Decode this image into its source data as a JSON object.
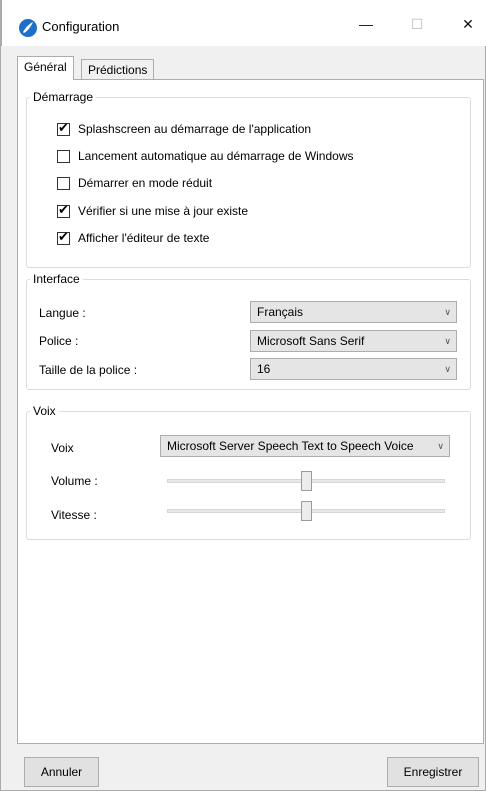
{
  "window": {
    "title": "Configuration"
  },
  "tabs": [
    {
      "label": "Général"
    },
    {
      "label": "Prédictions"
    }
  ],
  "startup": {
    "title": "Démarrage",
    "items": [
      {
        "label": "Splashscreen au démarrage de l'application",
        "checked": true
      },
      {
        "label": "Lancement automatique au démarrage de Windows",
        "checked": false
      },
      {
        "label": "Démarrer en mode réduit",
        "checked": false
      },
      {
        "label": "Vérifier si une mise à jour existe",
        "checked": true
      },
      {
        "label": "Afficher l'éditeur de texte",
        "checked": true
      }
    ]
  },
  "interface": {
    "title": "Interface",
    "language_label": "Langue :",
    "language_value": "Français",
    "font_label": "Police :",
    "font_value": "Microsoft Sans Serif",
    "font_size_label": "Taille de la police :",
    "font_size_value": "16"
  },
  "voice": {
    "title": "Voix",
    "voice_label": "Voix",
    "voice_value": "Microsoft Server Speech Text to Speech Voice",
    "volume_label": "Volume :",
    "volume_level": 0.5,
    "speed_label": "Vitesse :",
    "speed_level": 0.5
  },
  "buttons": {
    "cancel": "Annuler",
    "save": "Enregistrer"
  },
  "icons": {
    "app": "app-logo-icon",
    "minimize": "minimize-icon",
    "maximize": "maximize-icon",
    "close": "close-icon",
    "dropdown": "chevron-down-icon",
    "check": "checkmark-icon"
  }
}
